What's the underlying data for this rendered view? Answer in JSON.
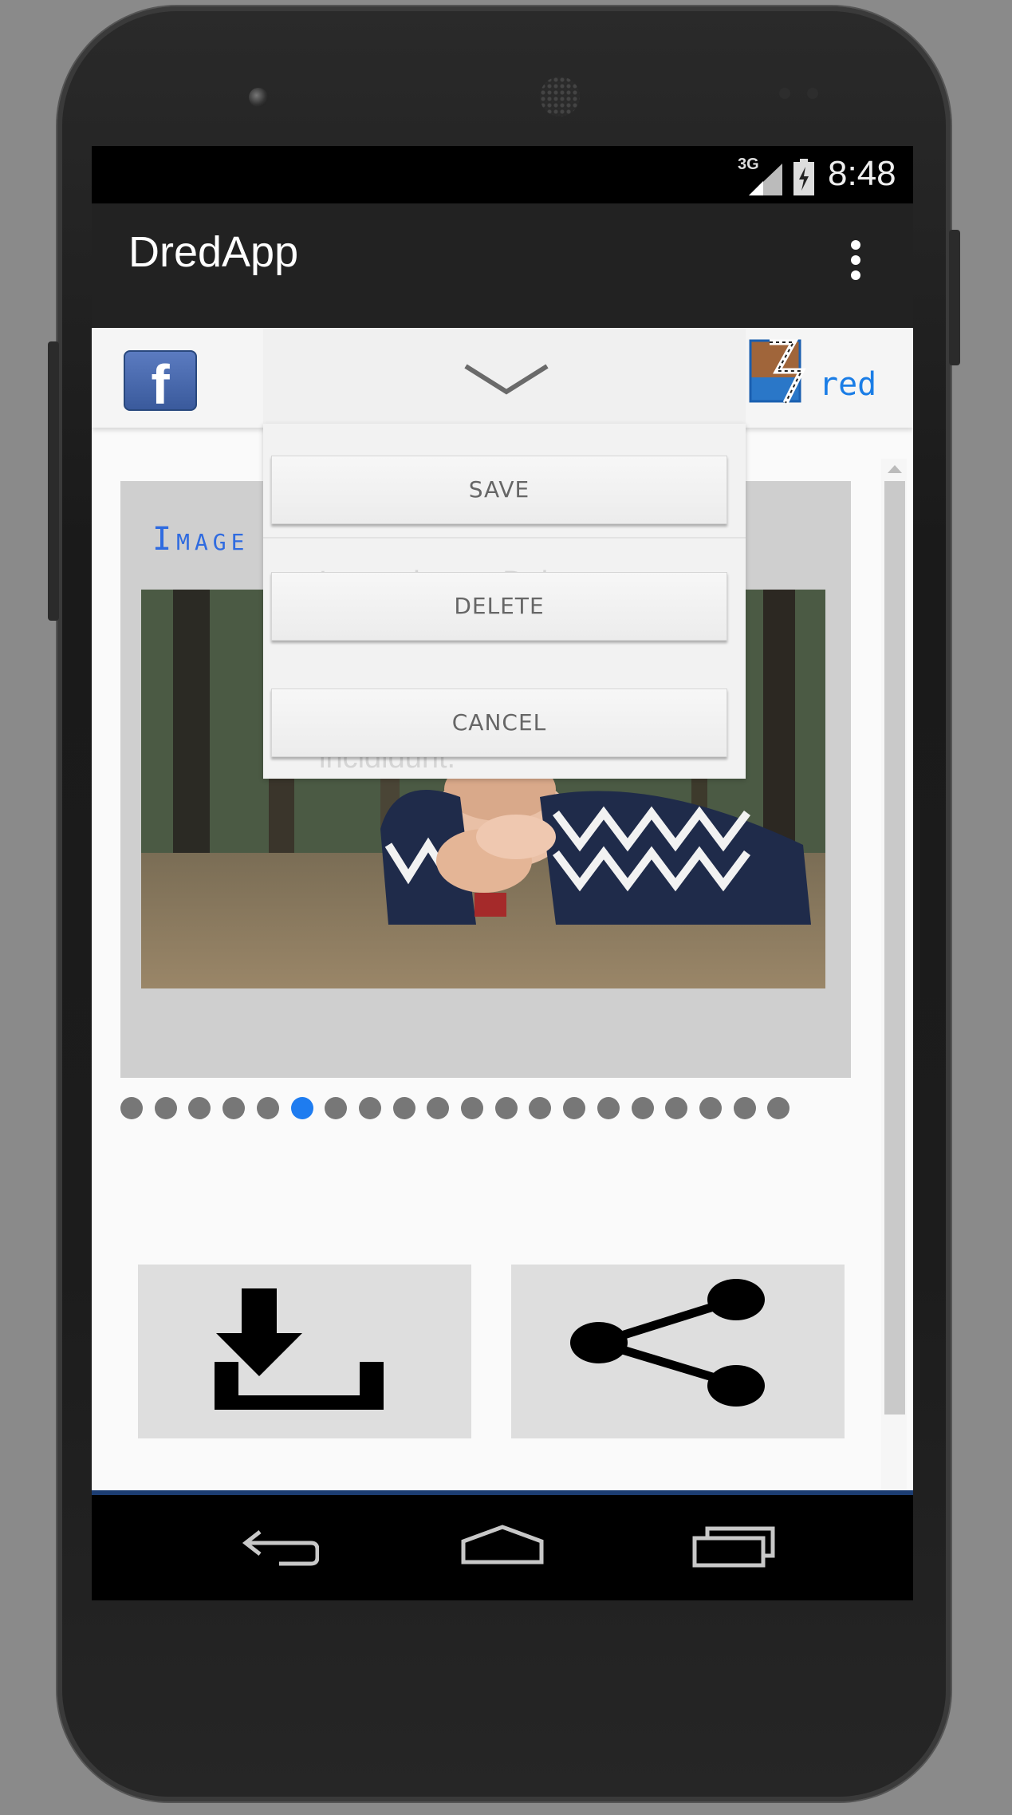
{
  "status_bar": {
    "network": "3G",
    "time": "8:48"
  },
  "action_bar": {
    "title": "DredApp",
    "overflow_icon": "overflow-menu-icon"
  },
  "top_bar": {
    "facebook_icon": "facebook-icon",
    "facebook_letter": "f",
    "drawer_icon": "chevron-down-icon",
    "logo_text": "red",
    "logo_icon": "dred-logo"
  },
  "card": {
    "title": "Image"
  },
  "pager": {
    "total": 20,
    "active_index": 5
  },
  "popup": {
    "save_label": "SAVE",
    "delete_label": "DELETE",
    "cancel_label": "CANCEL",
    "background_text_1": "Lorem ipsum Dolor",
    "background_text_2": "incididunt."
  },
  "actions": {
    "download_icon": "download-icon",
    "share_icon": "share-icon"
  },
  "nav_bar": {
    "back_icon": "back-icon",
    "home_icon": "home-icon",
    "recents_icon": "recents-icon"
  },
  "colors": {
    "accent": "#1e7cf0",
    "title_blue": "#2f6be0",
    "action_bar": "#222222",
    "facebook": "#3b5998"
  }
}
